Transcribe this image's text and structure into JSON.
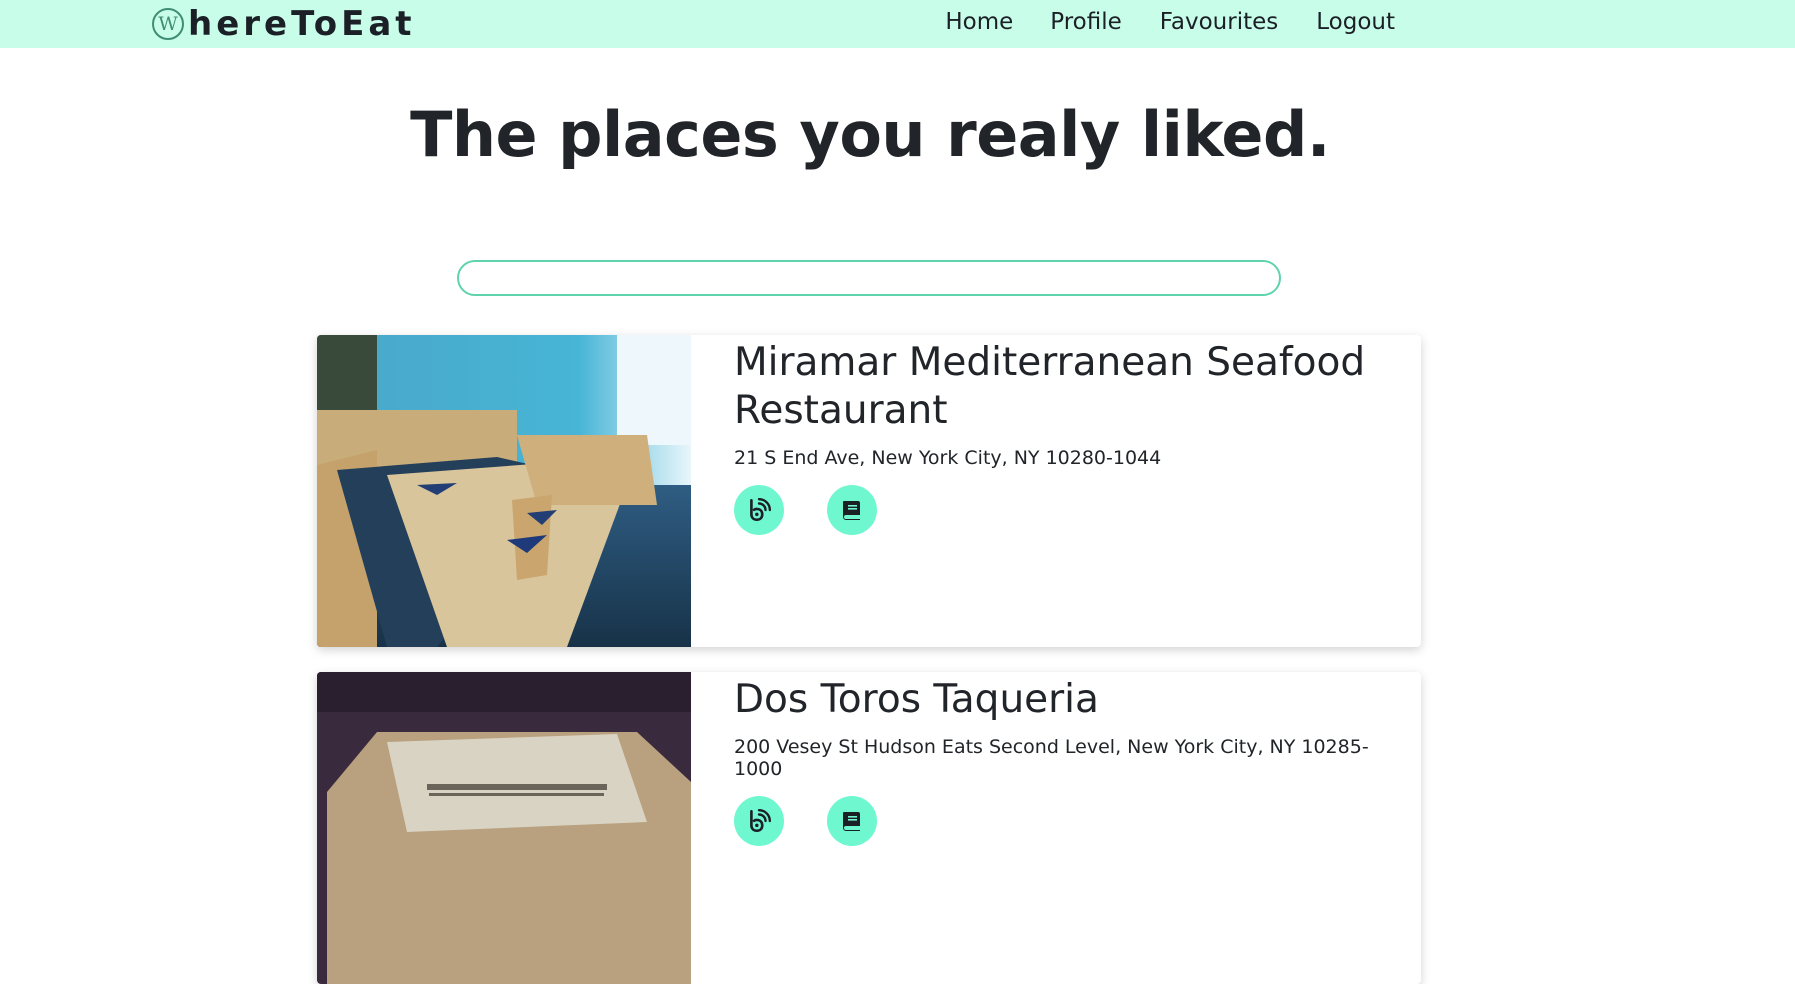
{
  "nav": {
    "brand_logo_letter": "W",
    "brand_text": "hereToEat",
    "links": [
      "Home",
      "Profile",
      "Favourites",
      "Logout"
    ]
  },
  "page": {
    "title": "The places you realy liked.",
    "search_value": ""
  },
  "restaurants": [
    {
      "name": "Miramar Mediterranean Seafood Restaurant",
      "address": "21 S End Ave, New York City, NY 10280-1044",
      "icons": [
        "location-dot-icon",
        "menu-book-icon"
      ]
    },
    {
      "name": "Dos Toros Taqueria",
      "address": "200 Vesey St Hudson Eats Second Level, New York City, NY 10285-1000",
      "icons": [
        "location-dot-icon",
        "menu-book-icon"
      ]
    }
  ],
  "colors": {
    "navbar_bg": "#c8fdea",
    "accent": "#6ff7d0",
    "search_border": "#5fd3ad",
    "text": "#212529"
  }
}
